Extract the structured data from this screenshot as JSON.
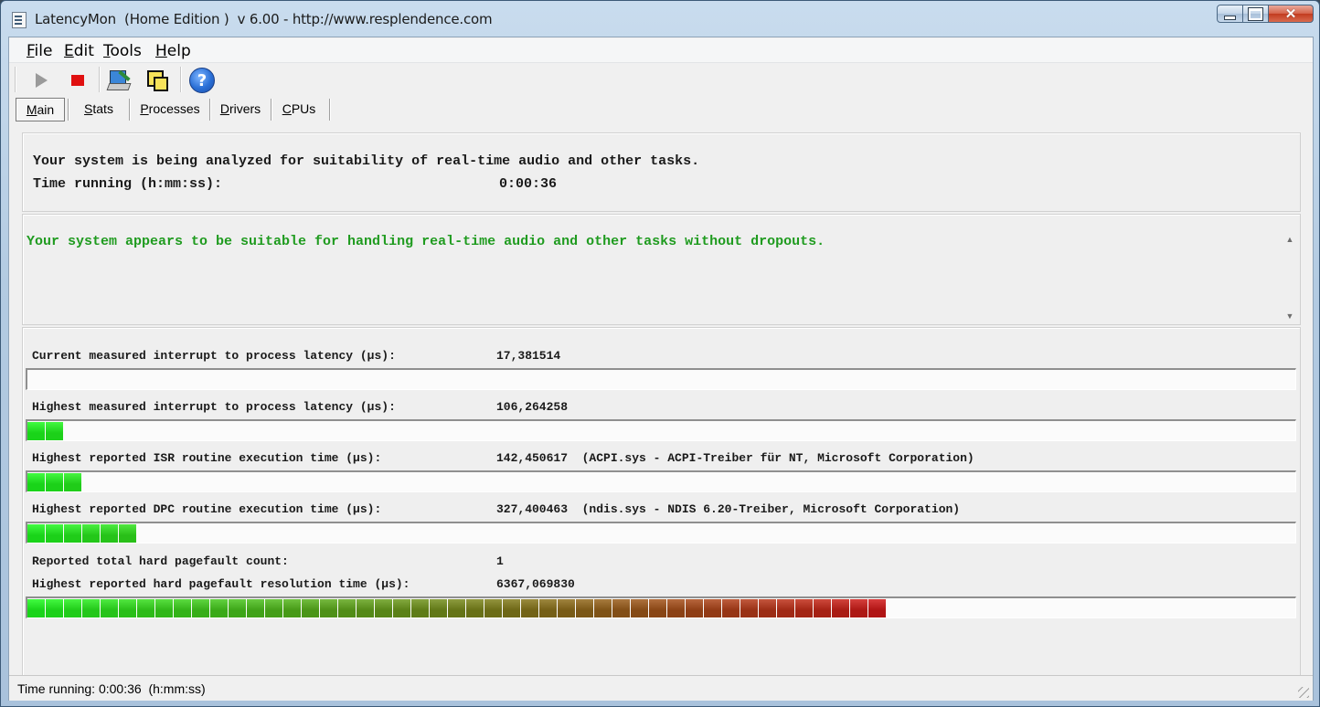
{
  "window": {
    "title": "LatencyMon  (Home Edition )  v 6.00 - http://www.resplendence.com"
  },
  "menu": [
    {
      "label": "File",
      "accel": "F",
      "rest": "ile"
    },
    {
      "label": "Edit",
      "accel": "E",
      "rest": "dit"
    },
    {
      "label": "Tools",
      "accel": "T",
      "rest": "ools"
    },
    {
      "label": "Help",
      "accel": "H",
      "rest": "elp"
    }
  ],
  "toolbar": {
    "icons": [
      "play-icon",
      "stop-icon",
      "tool-icon",
      "windows-icon",
      "help-icon"
    ],
    "help_glyph": "?"
  },
  "tabs": [
    {
      "label": "Main",
      "accel": "M",
      "rest": "ain",
      "active": true
    },
    {
      "label": "Stats",
      "accel": "S",
      "rest": "tats",
      "active": false
    },
    {
      "label": "Processes",
      "accel": "P",
      "rest": "rocesses",
      "active": false
    },
    {
      "label": "Drivers",
      "accel": "D",
      "rest": "rivers",
      "active": false
    },
    {
      "label": "CPUs",
      "accel": "C",
      "rest": "PUs",
      "active": false
    }
  ],
  "summary": {
    "line1": "Your system is being analyzed for suitability of real-time audio and other tasks.",
    "time_label": "Time running (h:mm:ss):",
    "time_value": "0:00:36"
  },
  "verdict": {
    "text": "Your system appears to be suitable for handling real-time audio and other tasks without dropouts.",
    "color": "#1f9b1f"
  },
  "metrics": [
    {
      "label": "Current measured interrupt to process latency (µs):",
      "value": "17,381514",
      "detail": "",
      "bar_segments": 0
    },
    {
      "label": "Highest measured interrupt to process latency (µs):",
      "value": "106,264258",
      "detail": "",
      "bar_segments": 2
    },
    {
      "label": "Highest reported ISR routine execution time (µs):",
      "value": "142,450617",
      "detail": "(ACPI.sys - ACPI-Treiber für NT, Microsoft Corporation)",
      "bar_segments": 3
    },
    {
      "label": "Highest reported DPC routine execution time (µs):",
      "value": "327,400463",
      "detail": "(ndis.sys - NDIS 6.20-Treiber, Microsoft Corporation)",
      "bar_segments": 6
    }
  ],
  "pagefault": {
    "count_label": "Reported total hard pagefault count:",
    "count_value": "1",
    "time_label": "Highest reported hard pagefault resolution time (µs):",
    "time_value": "6367,069830",
    "bar_segments": 47
  },
  "status": {
    "text": "Time running: 0:00:36  (h:mm:ss)"
  },
  "colors": {
    "bar_start": "#19d419",
    "bar_end": "#b01414"
  }
}
